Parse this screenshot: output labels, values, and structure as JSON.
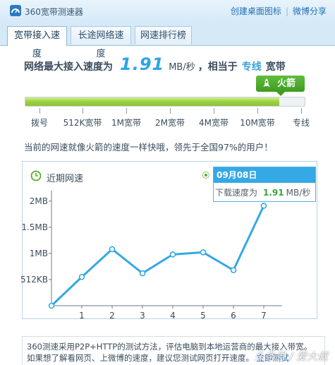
{
  "app": {
    "title": "360宽带测速器"
  },
  "top_links": {
    "create_shortcut": "创建桌面图标",
    "separator": "|",
    "weibo_share": "微博分享"
  },
  "tabs": [
    {
      "label": "宽带接入速度",
      "active": true
    },
    {
      "label": "长途网络速度",
      "active": false
    },
    {
      "label": "网速排行榜",
      "active": false
    }
  ],
  "result": {
    "prefix": "网络最大接入速度为",
    "speed_value": "1.91",
    "speed_unit": "MB/秒",
    "equivalent_prefix": "，相当于",
    "level_name": "专线",
    "level_suffix": "宽带"
  },
  "badge": {
    "label": "火箭",
    "icon": "rocket-icon",
    "color": "#4caa2c"
  },
  "speed_bar": {
    "scale_labels": [
      "拨号",
      "512K宽带",
      "1M宽带",
      "2M宽带",
      "4M宽带",
      "10M宽带",
      "专线"
    ],
    "progress_fraction": 0.91,
    "fill_colors": {
      "green": "#9fd23f",
      "blue": "#7cc6ef"
    }
  },
  "compare_text": "当前的网速就像火箭的速度一样快哦，领先于全国97%的用户！",
  "chart_data": {
    "type": "line",
    "title": "近期网速",
    "x": [
      0,
      1,
      2,
      3,
      4,
      5,
      6,
      7
    ],
    "xticks": [
      "1",
      "2",
      "3",
      "4",
      "5",
      "6",
      "7"
    ],
    "yticks": [
      "512KB",
      "1MB",
      "1.5MB",
      "2MB"
    ],
    "ytick_values": [
      0.5,
      1.0,
      1.5,
      2.0
    ],
    "ylim": [
      0,
      2.2
    ],
    "xlim": [
      0,
      7.6
    ],
    "series": [
      {
        "values": [
          0,
          0.55,
          1.08,
          0.62,
          0.98,
          1.02,
          0.68,
          1.91
        ],
        "color": "#35a8e6"
      }
    ],
    "tooltip": {
      "date": "09月08日",
      "label": "下载速度为",
      "value": "1.91",
      "unit": "MB/秒"
    }
  },
  "footer": {
    "line1": "360测速采用P2P+HTTP的测试方法，评估电脑到本地运营商的最大接入带宽。",
    "line2": "如果想了解看网页、上微博的速度，建议您测试网页打开速度。",
    "link": "立即测试"
  },
  "watermark": "头条号 / 爱大叔"
}
